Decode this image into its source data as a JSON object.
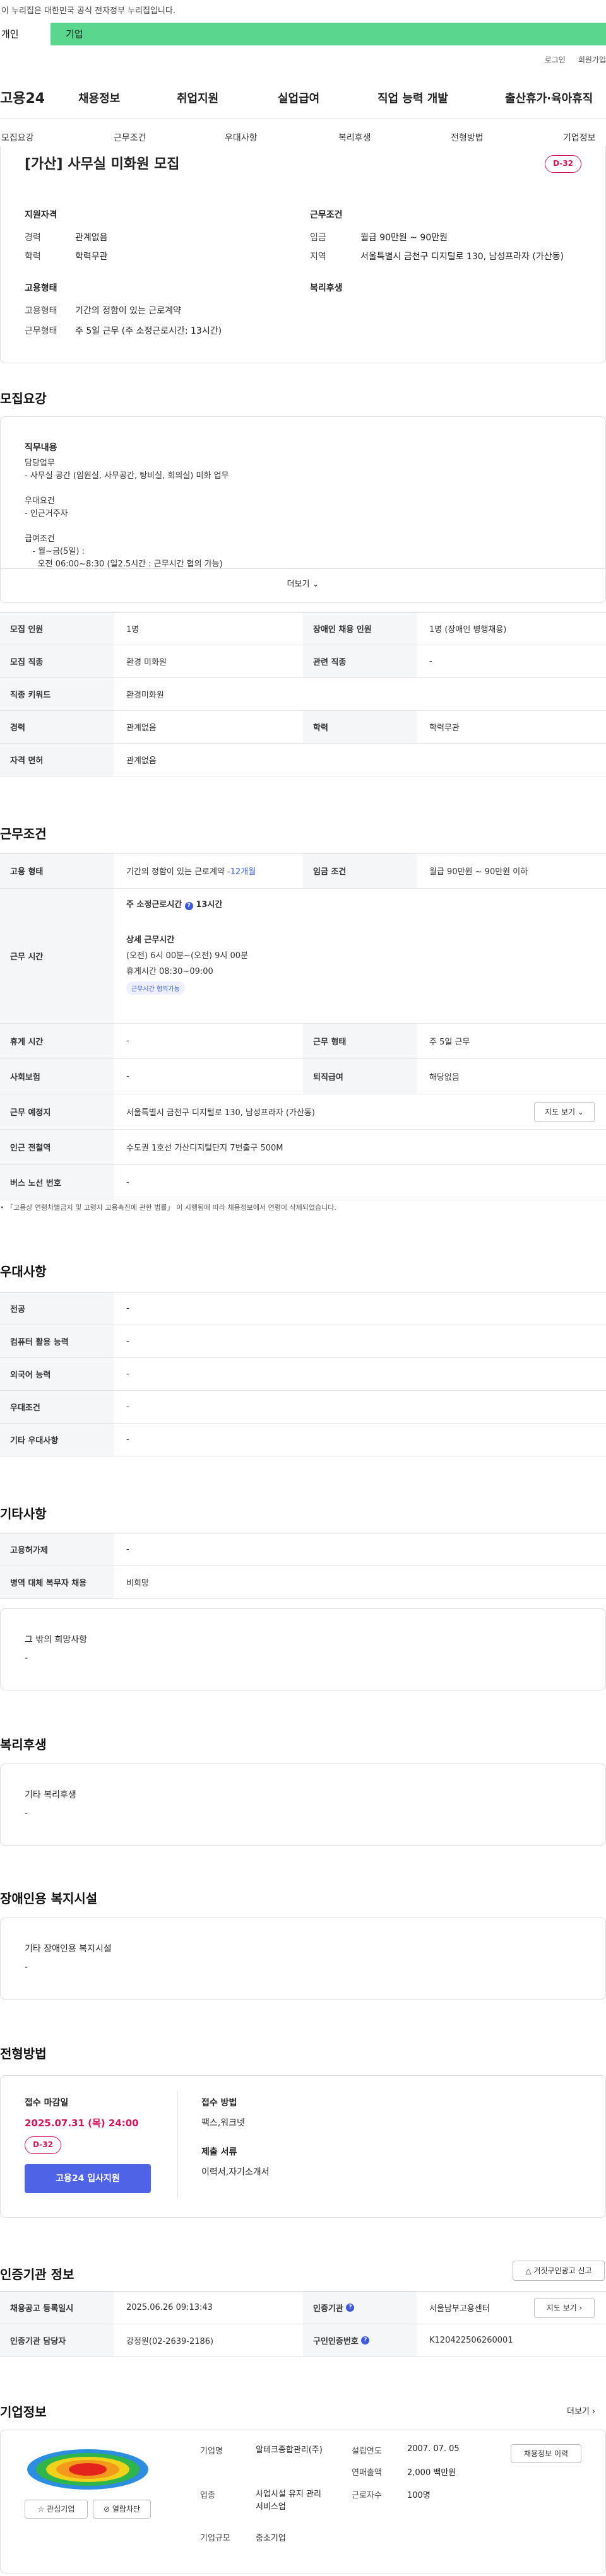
{
  "notice": "이 누리집은 대한민국 공식 전자정부 누리집입니다.",
  "top_tabs": {
    "personal": "개인",
    "company": "기업"
  },
  "util": {
    "login": "로그인",
    "join": "회원가입"
  },
  "logo": "고용24",
  "gnb": [
    "채용정보",
    "취업지원",
    "실업급여",
    "직업 능력 개발",
    "출산휴가·육아휴직"
  ],
  "subnav": [
    "모집요강",
    "근무조건",
    "우대사항",
    "복리후생",
    "전형방법",
    "기업정보"
  ],
  "header": {
    "title": "[가산] 사무실 미화원 모집",
    "dday": "D-32",
    "qual_title": "지원자격",
    "career_l": "경력",
    "career_v": "관계없음",
    "edu_l": "학력",
    "edu_v": "학력무관",
    "cond_title": "근무조건",
    "wage_l": "임금",
    "wage_v": "월급 90만원 ~ 90만원",
    "area_l": "지역",
    "area_v": "서울특별시 금천구 디지털로 130, 남성프라자 (가산동)",
    "emp_title": "고용형태",
    "emptype_l": "고용형태",
    "emptype_v": "기간의 정함이 있는 근로계약",
    "worktype_l": "근무형태",
    "worktype_v": "주 5일 근무 (주 소정근로시간: 13시간)",
    "welfare_title": "복리후생"
  },
  "recruit": {
    "title": "모집요강",
    "duty_title": "직무내용",
    "lines": [
      "담당업무",
      "- 사무실 공간 (임원실, 사무공간, 탕비실, 회의실) 미화 업무",
      "",
      "우대요건",
      "- 인근거주자",
      "",
      "급여조건",
      "   - 월~금(5일) :",
      "     오전 06:00~8:30 (일2.5시간 : 근무시간 협의 가능)"
    ],
    "more": "더보기",
    "rows": [
      [
        "모집 인원",
        "1명",
        "장애인 채용 인원",
        "1명 (장애인 병행채용)"
      ],
      [
        "모집 직종",
        "환경 미화원",
        "관련 직종",
        "-"
      ],
      [
        "직종 키워드",
        "환경미화원",
        "",
        ""
      ],
      [
        "경력",
        "관계없음",
        "학력",
        "학력무관"
      ],
      [
        "자격 면허",
        "관계없음",
        "",
        ""
      ]
    ]
  },
  "conditions": {
    "title": "근무조건",
    "emp_l": "고용 형태",
    "emp_v": "기간의 정함이 있는 근로계약 - ",
    "emp_months": "12개월",
    "wage_l": "임금 조건",
    "wage_v": "월급 90만원 ~ 90만원 이하",
    "time_l": "근무 시간",
    "weekly": "주 소정근로시간",
    "weekly_v": "13시간",
    "detail_t": "상세 근무시간",
    "detail_1": "(오전) 6시 00분~(오전) 9시 00분",
    "detail_2": "휴게시간 08:30~09:00",
    "negotiable": "근무시간 협의가능",
    "rest_l": "휴게 시간",
    "rest_v": "-",
    "wtype_l": "근무 형태",
    "wtype_v": "주 5일 근무",
    "ins_l": "사회보험",
    "ins_v": "-",
    "sev_l": "퇴직급여",
    "sev_v": "해당없음",
    "place_l": "근무 예정지",
    "place_v": "서울특별시 금천구 디지털로 130, 남성프라자 (가산동)",
    "map": "지도 보기",
    "sub_l": "인근 전철역",
    "sub_v": "수도권 1호선 가산디지털단지 7번출구 500M",
    "bus_l": "버스 노선 번호",
    "bus_v": "-",
    "footnote": "「고용상 연령차별금지 및 고령자 고용촉진에 관한 법률」 이 시행됨에 따라 채용정보에서 연령이 삭제되었습니다."
  },
  "pref": {
    "title": "우대사항",
    "rows": [
      [
        "전공",
        "-"
      ],
      [
        "컴퓨터 활용 능력",
        "-"
      ],
      [
        "외국어 능력",
        "-"
      ],
      [
        "우대조건",
        "-"
      ],
      [
        "기타 우대사항",
        "-"
      ]
    ]
  },
  "etc": {
    "title": "기타사항",
    "rows": [
      [
        "고용허가제",
        "-"
      ],
      [
        "병역 대체 복무자 채용",
        "비희망"
      ]
    ],
    "hope_t": "그 밖의 희망사항",
    "hope_v": "-"
  },
  "welfare": {
    "title": "복리후생",
    "sub": "기타 복리후생",
    "v": "-"
  },
  "disab": {
    "title": "장애인용 복지시설",
    "sub": "기타 장애인용 복지시설",
    "v": "-"
  },
  "selection": {
    "title": "전형방법",
    "deadline_t": "접수 마감일",
    "deadline_v": "2025.07.31 (목) 24:00",
    "dday": "D-32",
    "apply": "고용24 입사지원",
    "method_t": "접수 방법",
    "method_v": "팩스,워크넷",
    "docs_t": "제출 서류",
    "docs_v": "이력서,자기소개서"
  },
  "agency": {
    "title": "인증기관 정보",
    "report": "거짓구인광고 신고",
    "reg_l": "채용공고 등록일시",
    "reg_v": "2025.06.26 09:13:43",
    "cert_l": "인증기관",
    "cert_v": "서울남부고용센터",
    "map": "지도 보기",
    "mgr_l": "인증기관 담당자",
    "mgr_v": "강정원(02-2639-2186)",
    "num_l": "구인인증번호",
    "num_v": "K120422506260001"
  },
  "company": {
    "title": "기업정보",
    "more": "더보기",
    "name_l": "기업명",
    "name_v": "알테크종합관리(주)",
    "found_l": "설립연도",
    "found_v": "2007. 07. 05",
    "sales_l": "연매출액",
    "sales_v": "2,000 백만원",
    "ind_l": "업종",
    "ind_v": "사업시설 유지 관리 서비스업",
    "emp_l": "근로자수",
    "emp_v": "100명",
    "size_l": "기업규모",
    "size_v": "중소기업",
    "jobs_btn": "채용정보 이력",
    "fav": "관심기업",
    "block": "열람차단"
  }
}
